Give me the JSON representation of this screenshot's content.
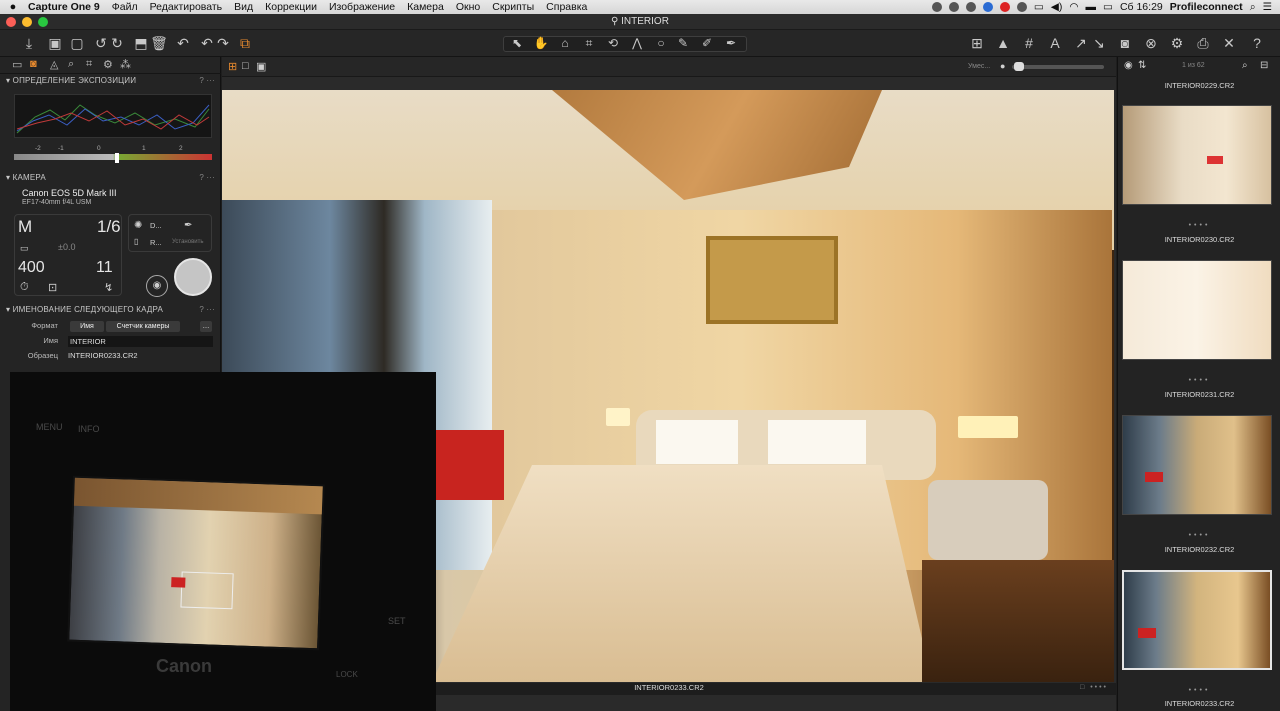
{
  "menubar": {
    "app": "Capture One 9",
    "items": [
      "Файл",
      "Редактировать",
      "Вид",
      "Коррекции",
      "Изображение",
      "Камера",
      "Окно",
      "Скрипты",
      "Справка"
    ],
    "clock": "Сб 16:29",
    "user": "Profileconnect"
  },
  "window": {
    "title": "INTERIOR"
  },
  "left": {
    "exposure_title": "ОПРЕДЕЛЕНИЕ ЭКСПОЗИЦИИ",
    "ev_ticks": [
      "-2",
      "-1",
      "0",
      "1",
      "2"
    ],
    "camera_title": "КАМЕРА",
    "camera_model": "Canon EOS 5D Mark III",
    "camera_lens": "EF17-40mm f/4L USM",
    "mode": "M",
    "shutter": "1/6",
    "ev_comp": "±0.0",
    "iso": "400",
    "aperture": "11",
    "wb_label": "D...",
    "raw_label": "R...",
    "set_label": "Установить",
    "naming_title": "ИМЕНОВАНИЕ СЛЕДУЮЩЕГО КАДРА",
    "format_label": "Формат",
    "format_tokens": [
      "Имя",
      "Счетчик камеры"
    ],
    "name_label": "Имя",
    "name_value": "INTERIOR",
    "sample_label": "Образец",
    "sample_value": "INTERIOR0233.CR2"
  },
  "viewer": {
    "caption": "INTERIOR0233.CR2",
    "zoom_label": "Умес..."
  },
  "browser": {
    "counter": "1 из 62",
    "thumbs": [
      {
        "name": "INTERIOR0229.CR2"
      },
      {
        "name": "INTERIOR0230.CR2"
      },
      {
        "name": "INTERIOR0231.CR2"
      },
      {
        "name": "INTERIOR0232.CR2"
      },
      {
        "name": "INTERIOR0233.CR2"
      }
    ]
  },
  "overlay": {
    "labels": [
      "MENU",
      "INFO",
      "SET",
      "LOCK",
      "Canon"
    ]
  }
}
